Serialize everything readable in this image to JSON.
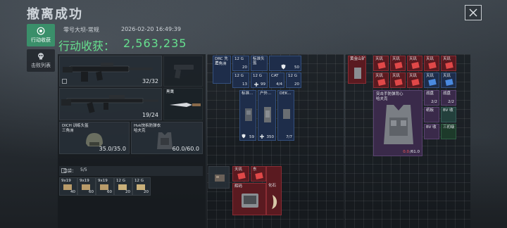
{
  "header": {
    "title": "撤离成功",
    "map_name": "零号大坝-常规",
    "datetime": "2026-02-20 16:49:39",
    "total_label": "行动收获：",
    "total_value": "2,563,235"
  },
  "side_tabs": [
    {
      "label": "行动收获",
      "icon": "target-icon",
      "active": true
    },
    {
      "label": "击败列表",
      "icon": "skull-icon",
      "active": false
    }
  ],
  "colors": {
    "accent_green": "#66e08f",
    "tab_active": "#3a8f6a",
    "rarity_red": "#5a1a20",
    "rarity_blue": "#1e2d4a",
    "rarity_purple": "#3a2a4a",
    "rarity_green": "#1d3a2a"
  },
  "weapons": {
    "primary_ammo": "32/32",
    "secondary_ammo": "19/24",
    "melee_label": "黑鹰"
  },
  "helmet": {
    "name_line1": "DICH 训练头盔",
    "name_line2": "三角洲",
    "durability": "35.0/35.0"
  },
  "armor": {
    "name_line1": "Hvk快拆防弹衣",
    "name_line2": "哈夫克",
    "durability": "60.0/60.0"
  },
  "pocket": {
    "label": "口袋：",
    "count": "5/5"
  },
  "pocket_items": [
    {
      "top": "9x19",
      "count": "40"
    },
    {
      "top": "9x19",
      "count": "60"
    },
    {
      "top": "9x19",
      "count": "60"
    },
    {
      "top": "12 G",
      "count": "20"
    },
    {
      "top": "12 G",
      "count": "20"
    }
  ],
  "chest_rig_slots": [
    {
      "top": "DRC 先进",
      "sub": "三角洲",
      "count": ""
    },
    {
      "top": "12 G",
      "count": "20"
    },
    {
      "top": "标准头盔",
      "count": ""
    },
    {
      "top": "",
      "count": "50",
      "icon": "shield-icon"
    },
    {
      "top": "12 G",
      "count": "13"
    },
    {
      "top": "12 G",
      "count": "99",
      "icon": "plus-icon"
    },
    {
      "top": "CAT",
      "count": "4/4"
    },
    {
      "top": "12 G",
      "count": "20"
    }
  ],
  "backpack_items": [
    {
      "top": "标准...",
      "count": "59",
      "icon": "shield-icon"
    },
    {
      "top": "户外...",
      "count": "350",
      "icon": "plus-icon"
    },
    {
      "top": "DEK...",
      "count": "7/7"
    }
  ],
  "safebox": {
    "items": [
      {
        "top": "天玑",
        "style": "red"
      },
      {
        "top": "东",
        "style": "red"
      },
      {
        "top": "辉码",
        "style": "red"
      },
      {
        "top": "化石",
        "style": "red"
      }
    ]
  },
  "right_panel": {
    "top_item": "黄金山矿",
    "vest_name_line1": "突击手防弹背心",
    "vest_name_line2": "哈夫克",
    "vest_durability_current": "0.0",
    "vest_durability_max": "/61.0",
    "mini_items": [
      {
        "top": "天玑",
        "style": "red"
      },
      {
        "top": "天玑",
        "style": "red"
      },
      {
        "top": "天玑",
        "style": "red"
      },
      {
        "top": "天玑",
        "style": "red"
      },
      {
        "top": "天玑",
        "style": "red"
      },
      {
        "top": "天玑",
        "style": "red"
      },
      {
        "top": "天玑",
        "style": "red"
      },
      {
        "top": "天玑",
        "style": "red"
      },
      {
        "top": "天玑",
        "style": "blue"
      },
      {
        "top": "天玑",
        "style": "blue"
      }
    ],
    "side_items": [
      {
        "top": "战盘",
        "count": "2/2"
      },
      {
        "top": "战盘",
        "count": "2/2"
      },
      {
        "top": "纸板",
        "count": ""
      },
      {
        "top": "BV 收",
        "count": ""
      },
      {
        "top": "BV 收",
        "count": ""
      },
      {
        "top": "三初级",
        "count": ""
      }
    ]
  }
}
